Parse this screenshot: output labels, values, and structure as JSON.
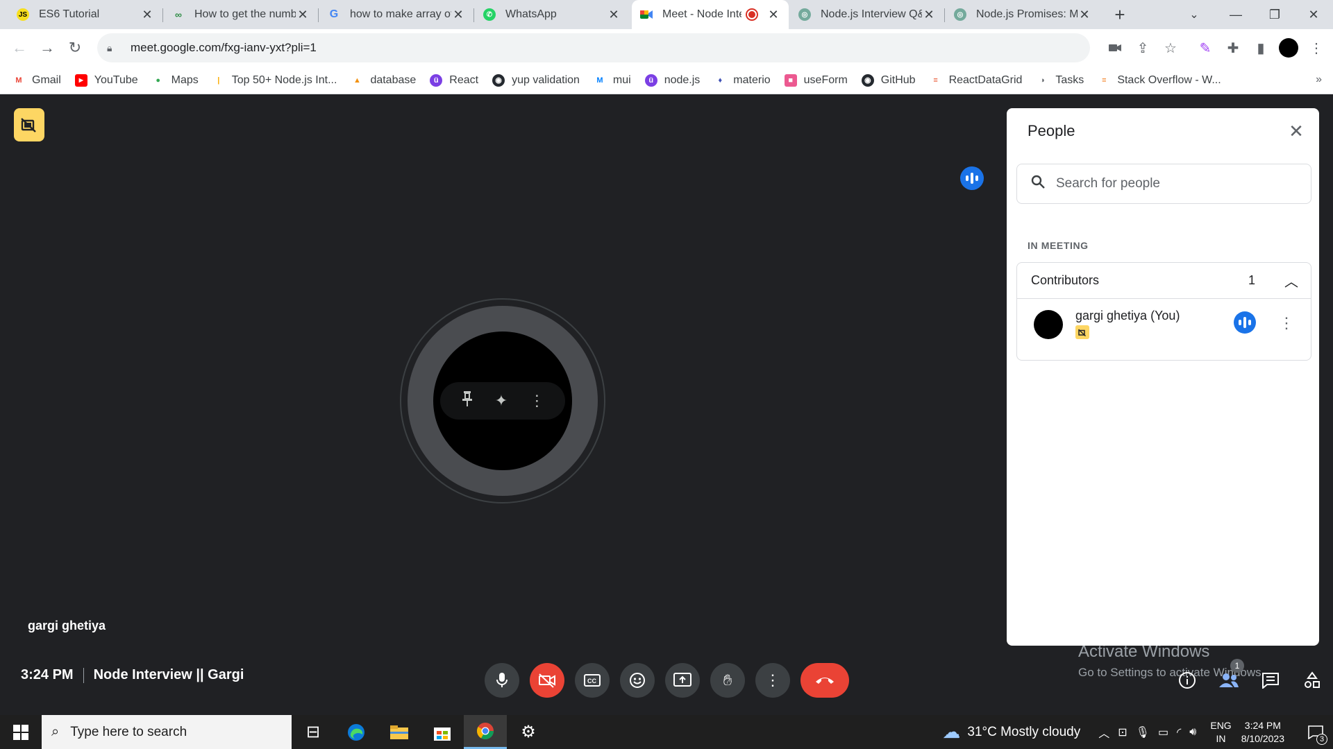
{
  "browser": {
    "tabs": [
      {
        "title": "ES6 Tutorial",
        "favicon": "JS",
        "fav_bg": "#f7df1e",
        "fav_fg": "#000"
      },
      {
        "title": "How to get the numb",
        "favicon": "∞",
        "fav_bg": "#ffffff",
        "fav_fg": "#2f8d46"
      },
      {
        "title": "how to make array of",
        "favicon": "G",
        "fav_bg": "#ffffff",
        "fav_fg": "#4285f4"
      },
      {
        "title": "WhatsApp",
        "favicon": "✆",
        "fav_bg": "#25d366",
        "fav_fg": "#fff"
      },
      {
        "title": "Meet - Node Inte",
        "favicon": "▶",
        "fav_bg": "#ffffff",
        "fav_fg": "#00832d"
      },
      {
        "title": "Node.js Interview Q&",
        "favicon": "◎",
        "fav_bg": "#74aa9c",
        "fav_fg": "#fff"
      },
      {
        "title": "Node.js Promises: Ma",
        "favicon": "◎",
        "fav_bg": "#74aa9c",
        "fav_fg": "#fff"
      }
    ],
    "address": "meet.google.com/fxg-ianv-yxt?pli=1",
    "bookmarks": [
      {
        "label": "Gmail",
        "icon": "M",
        "color": "#ea4335"
      },
      {
        "label": "YouTube",
        "icon": "▶",
        "color": "#ff0000"
      },
      {
        "label": "Maps",
        "icon": "●",
        "color": "#34a853"
      },
      {
        "label": "Top 50+ Node.js Int...",
        "icon": "|",
        "color": "#f9ab00"
      },
      {
        "label": "database",
        "icon": "▲",
        "color": "#f29111"
      },
      {
        "label": "React",
        "icon": "ü",
        "color": "#7b3fe4"
      },
      {
        "label": "yup validation",
        "icon": "◉",
        "color": "#24292f"
      },
      {
        "label": "mui",
        "icon": "M",
        "color": "#007fff"
      },
      {
        "label": "node.js",
        "icon": "ü",
        "color": "#7b3fe4"
      },
      {
        "label": "materio",
        "icon": "♦",
        "color": "#3f51b5"
      },
      {
        "label": "useForm",
        "icon": "■",
        "color": "#ec5990"
      },
      {
        "label": "GitHub",
        "icon": "◉",
        "color": "#24292f"
      },
      {
        "label": "ReactDataGrid",
        "icon": "≡",
        "color": "#e8542f"
      },
      {
        "label": "Tasks",
        "icon": "◑",
        "color": "#5f6368"
      },
      {
        "label": "Stack Overflow - W...",
        "icon": "≡",
        "color": "#f48024"
      }
    ]
  },
  "meet": {
    "self_name": "gargi ghetiya",
    "time": "3:24 PM",
    "meeting_title": "Node Interview || Gargi",
    "participant_count": "1"
  },
  "people_panel": {
    "title": "People",
    "search_placeholder": "Search for people",
    "section_label": "IN MEETING",
    "group_label": "Contributors",
    "group_count": "1",
    "person_name": "gargi ghetiya (You)"
  },
  "watermark": {
    "line1": "Activate Windows",
    "line2": "Go to Settings to activate Windows."
  },
  "taskbar": {
    "search_placeholder": "Type here to search",
    "weather": "31°C  Mostly cloudy",
    "lang_line1": "ENG",
    "lang_line2": "IN",
    "time": "3:24 PM",
    "date": "8/10/2023",
    "notification_count": "3"
  },
  "colors": {
    "meet_bg": "#202124",
    "accent_blue": "#1a73e8",
    "end_call_red": "#ea4335",
    "badge_yellow": "#fdd663"
  }
}
